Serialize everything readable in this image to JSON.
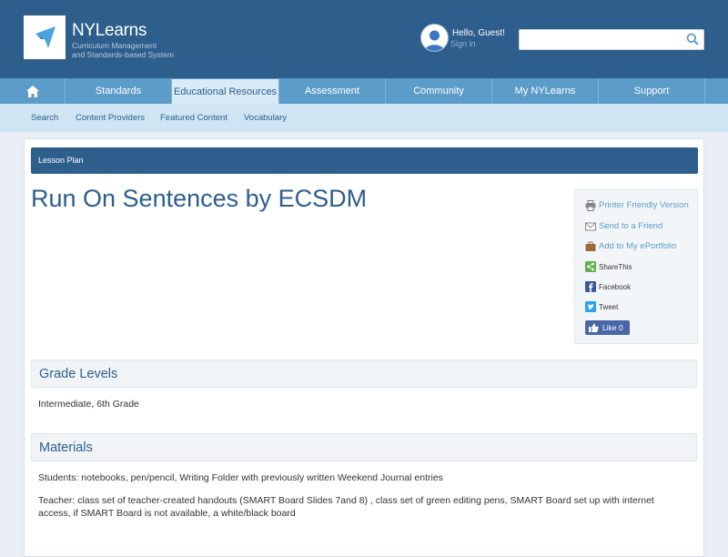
{
  "header": {
    "logo_title": "NYLearns",
    "logo_sub_1": "Curriculum Management",
    "logo_sub_2": "and Standards-based System",
    "greeting": "Hello, Guest!",
    "signin": "Sign in",
    "search_value": "",
    "colors": {
      "brand": "#2e5e8c",
      "nav": "#5b9cc9",
      "subnav": "#cfe5f4"
    }
  },
  "nav": {
    "home_icon": "home-icon",
    "items": [
      "Standards",
      "Educational Resources",
      "Assessment",
      "Community",
      "My NYLearns",
      "Support"
    ],
    "active": "Educational Resources"
  },
  "subnav": {
    "items": [
      "Search",
      "Content Providers",
      "Featured Content",
      "Vocabulary"
    ]
  },
  "page": {
    "breadcrumb": "Lesson Plan",
    "title": "Run On Sentences by ECSDM"
  },
  "share": {
    "printer": "Printer Friendly Version",
    "send": "Send to a Friend",
    "portfolio": "Add to My ePortfolio",
    "sharethis": "ShareThis",
    "facebook": "Facebook",
    "tweet": "Tweet",
    "like": "Like 0"
  },
  "sections": {
    "grade_title": "Grade Levels",
    "grade_text": "Intermediate, 6th Grade",
    "materials_title": "Materials",
    "materials_students": "Students: notebooks, pen/pencil, Writing Folder with previously written Weekend Journal entries",
    "materials_teacher": "Teacher: class set of teacher-created handouts (SMART Board Slides 7and 8) , class set of green editing pens, SMART Board set up with internet access, if SMART Board is not available, a white/black board"
  }
}
